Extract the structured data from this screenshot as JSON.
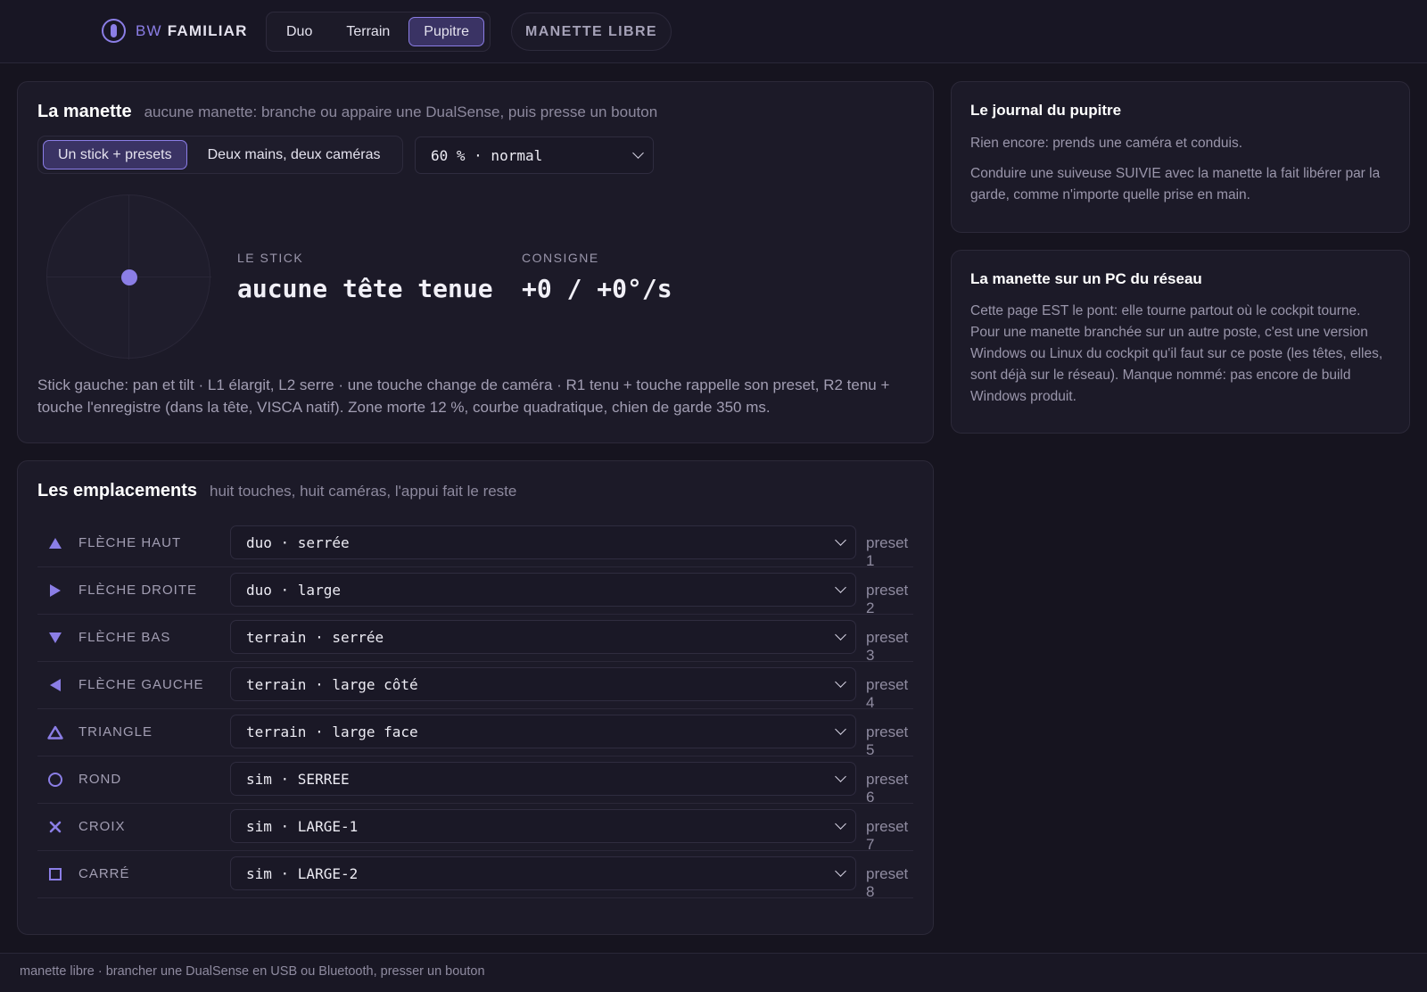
{
  "header": {
    "brand_prefix": "BW",
    "brand_name": "FAMILIAR",
    "tabs": [
      "Duo",
      "Terrain",
      "Pupitre"
    ],
    "active_tab": "Pupitre",
    "mode_button": "MANETTE LIBRE"
  },
  "manette": {
    "title": "La manette",
    "subtitle": "aucune manette: branche ou appaire une DualSense, puis presse un bouton",
    "modes": [
      "Un stick + presets",
      "Deux mains, deux caméras"
    ],
    "active_mode": "Un stick + presets",
    "speed_select": "60 % · normal",
    "stick": {
      "x": 0,
      "y": 0
    },
    "stick_label": "LE STICK",
    "stick_value": "aucune tête tenue",
    "consigne_label": "CONSIGNE",
    "consigne_value": "+0 / +0°/s",
    "help": "Stick gauche: pan et tilt · L1 élargit, L2 serre · une touche change de caméra · R1 tenu + touche rappelle son preset, R2 tenu + touche l'enregistre (dans la tête, VISCA natif). Zone morte 12 %, courbe quadratique, chien de garde 350 ms."
  },
  "emplacements": {
    "title": "Les emplacements",
    "subtitle": "huit touches, huit caméras, l'appui fait le reste",
    "slots": [
      {
        "icon": "arrow-up-icon",
        "label": "FLÈCHE HAUT",
        "value": "duo · serrée",
        "preset": "preset 1"
      },
      {
        "icon": "arrow-right-icon",
        "label": "FLÈCHE DROITE",
        "value": "duo · large",
        "preset": "preset 2"
      },
      {
        "icon": "arrow-down-icon",
        "label": "FLÈCHE BAS",
        "value": "terrain · serrée",
        "preset": "preset 3"
      },
      {
        "icon": "arrow-left-icon",
        "label": "FLÈCHE GAUCHE",
        "value": "terrain · large côté",
        "preset": "preset 4"
      },
      {
        "icon": "triangle-icon",
        "label": "TRIANGLE",
        "value": "terrain · large face",
        "preset": "preset 5"
      },
      {
        "icon": "circle-icon",
        "label": "ROND",
        "value": "sim · SERREE",
        "preset": "preset 6"
      },
      {
        "icon": "cross-icon",
        "label": "CROIX",
        "value": "sim · LARGE-1",
        "preset": "preset 7"
      },
      {
        "icon": "square-icon",
        "label": "CARRÉ",
        "value": "sim · LARGE-2",
        "preset": "preset 8"
      }
    ]
  },
  "journal": {
    "title": "Le journal du pupitre",
    "line1": "Rien encore: prends une caméra et conduis.",
    "line2": "Conduire une suiveuse SUIVIE avec la manette la fait libérer par la garde, comme n'importe quelle prise en main."
  },
  "reseau": {
    "title": "La manette sur un PC du réseau",
    "text": "Cette page EST le pont: elle tourne partout où le cockpit tourne. Pour une manette branchée sur un autre poste, c'est une version Windows ou Linux du cockpit qu'il faut sur ce poste (les têtes, elles, sont déjà sur le réseau). Manque nommé: pas encore de build Windows produit."
  },
  "footer": {
    "status": "manette libre · brancher une DualSense en USB ou Bluetooth, presser un bouton"
  },
  "colors": {
    "accent": "#8b7ee6",
    "background": "#16141f",
    "card": "#1c1a28"
  }
}
